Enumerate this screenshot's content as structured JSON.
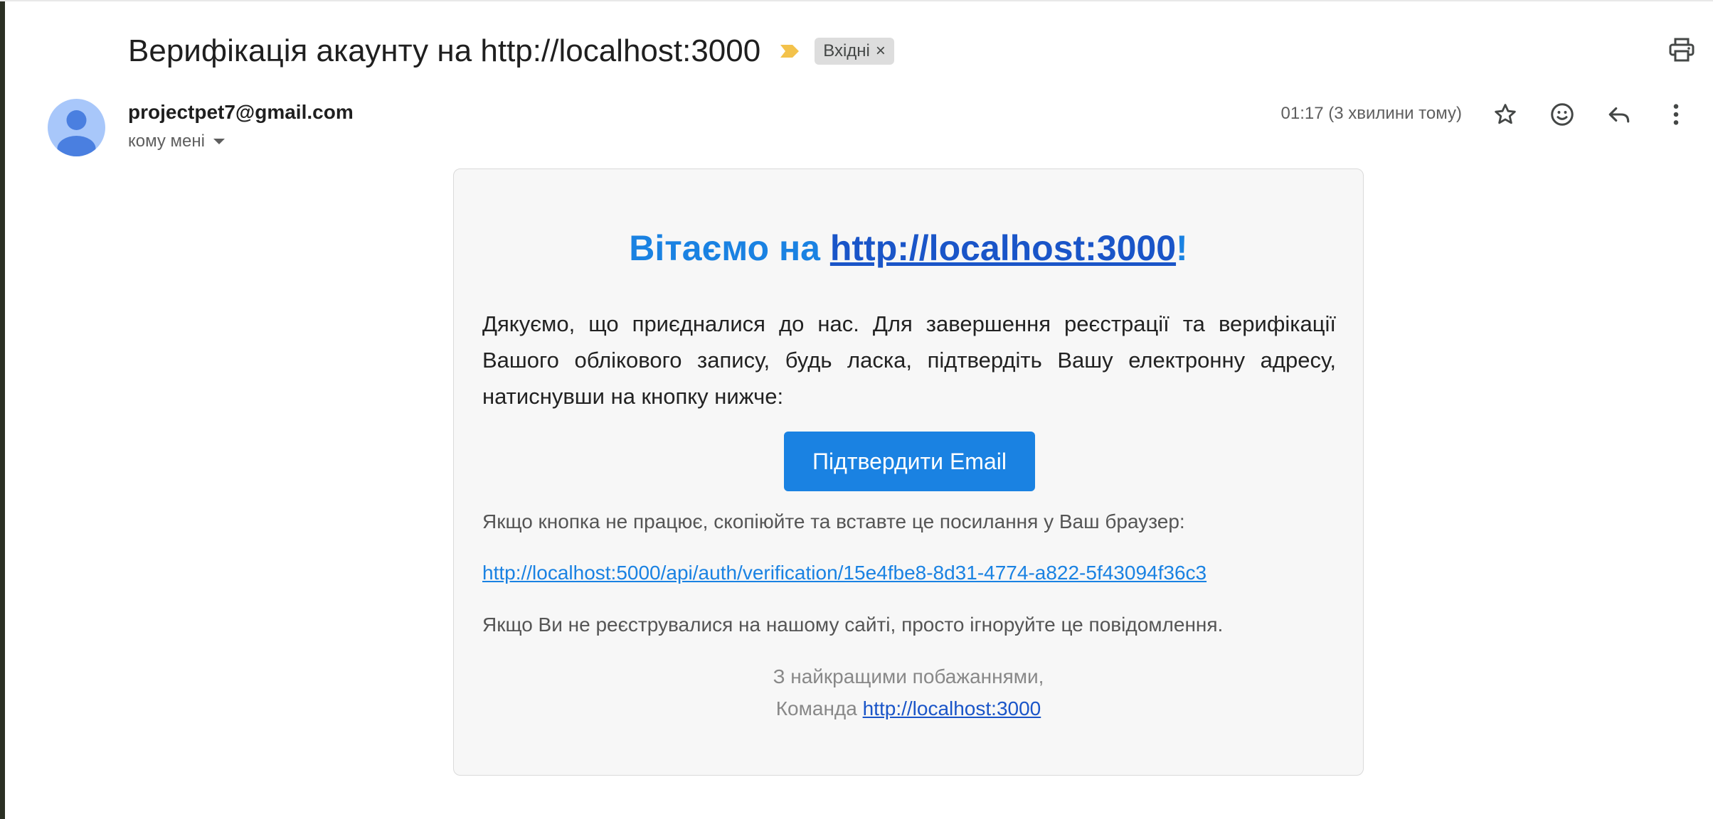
{
  "subject": {
    "title": "Верифікація акаунту на http://localhost:3000",
    "importance_icon": "importance-marker-icon",
    "label": "Вхідні",
    "label_remove": "×",
    "colors": {
      "importance": "#f3c24b",
      "chip_bg": "#dddddd"
    }
  },
  "sender": {
    "email": "projectpet7@gmail.com",
    "recipient": "кому мені",
    "timestamp": "01:17 (3 хвилини тому)"
  },
  "toolbar": {
    "print_icon": "print-icon",
    "star_icon": "star-icon",
    "emoji_icon": "emoji-reaction-icon",
    "reply_icon": "reply-icon",
    "more_icon": "more-vertical-icon"
  },
  "email_body": {
    "heading_prefix": "Вітаємо на ",
    "heading_link": "http://localhost:3000",
    "heading_suffix": "!",
    "intro": "Дякуємо, що приєдналися до нас. Для завершення реєстрації та верифікації Вашого облікового запису, будь ласка, підтвердіть Вашу електронну адресу, натиснувши на кнопку нижче:",
    "button_label": "Підтвердити Email",
    "fallback_text": "Якщо кнопка не працює, скопіюйте та вставте це посилання у Ваш браузер:",
    "verification_link": "http://localhost:5000/api/auth/verification/15e4fbe8-8d31-4774-a822-5f43094f36c3",
    "ignore_text": "Якщо Ви не реєструвалися на нашому сайті, просто ігноруйте це повідомлення.",
    "regards": "З найкращими побажаннями,",
    "team_prefix": "Команда ",
    "team_link": "http://localhost:3000",
    "colors": {
      "accent": "#1a82e2",
      "link_dark": "#1a55c8",
      "card_bg": "#f7f7f7"
    }
  }
}
